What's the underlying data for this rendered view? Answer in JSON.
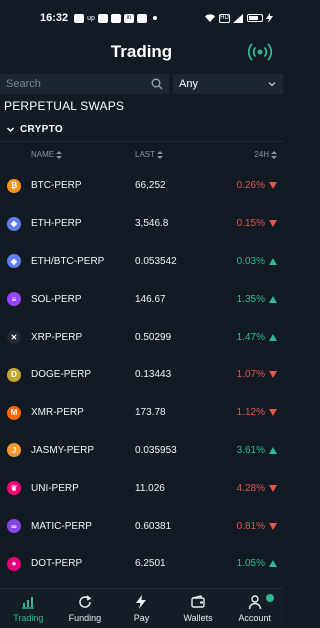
{
  "status_bar": {
    "time": "16:32",
    "icons": [
      "app-icon",
      "up-icon",
      "mail-icon",
      "mail-icon",
      "linkedin-icon",
      "chat-icon",
      "dot-icon"
    ],
    "right_icons": [
      "wifi-icon",
      "hd-icon",
      "signal-icon",
      "battery-icon",
      "lightning-icon"
    ]
  },
  "header": {
    "title": "Trading",
    "action_icon": "broadcast-icon"
  },
  "search": {
    "placeholder": "Search",
    "filter_value": "Any"
  },
  "section": {
    "title": "PERPETUAL SWAPS"
  },
  "group": {
    "title": "CRYPTO"
  },
  "columns": {
    "name": "NAME",
    "last": "LAST",
    "change": "24H"
  },
  "colors": {
    "background": "#121a24",
    "positive": "#2fb98e",
    "negative": "#e0584f",
    "accent": "#2fb98e"
  },
  "rows": [
    {
      "name": "BTC-PERP",
      "last": "66,252",
      "change": "0.26%",
      "dir": "down",
      "icon": "bitcoin-icon",
      "color": "#f7931a"
    },
    {
      "name": "ETH-PERP",
      "last": "3,546.8",
      "change": "0.15%",
      "dir": "down",
      "icon": "ethereum-icon",
      "color": "#627eea"
    },
    {
      "name": "ETH/BTC-PERP",
      "last": "0.053542",
      "change": "0.03%",
      "dir": "up",
      "icon": "ethereum-icon",
      "color": "#627eea"
    },
    {
      "name": "SOL-PERP",
      "last": "146.67",
      "change": "1.35%",
      "dir": "up",
      "icon": "solana-icon",
      "color": "#9945ff"
    },
    {
      "name": "XRP-PERP",
      "last": "0.50299",
      "change": "1.47%",
      "dir": "up",
      "icon": "xrp-icon",
      "color": "#23292f"
    },
    {
      "name": "DOGE-PERP",
      "last": "0.13443",
      "change": "1.07%",
      "dir": "down",
      "icon": "dogecoin-icon",
      "color": "#c2a633"
    },
    {
      "name": "XMR-PERP",
      "last": "173.78",
      "change": "1.12%",
      "dir": "down",
      "icon": "monero-icon",
      "color": "#ff6600"
    },
    {
      "name": "JASMY-PERP",
      "last": "0.035953",
      "change": "3.61%",
      "dir": "up",
      "icon": "jasmy-icon",
      "color": "#f29a2e"
    },
    {
      "name": "UNI-PERP",
      "last": "11.026",
      "change": "4.28%",
      "dir": "down",
      "icon": "uniswap-icon",
      "color": "#ff007a"
    },
    {
      "name": "MATIC-PERP",
      "last": "0.60381",
      "change": "0.81%",
      "dir": "down",
      "icon": "polygon-icon",
      "color": "#8247e5"
    },
    {
      "name": "DOT-PERP",
      "last": "6.2501",
      "change": "1.05%",
      "dir": "up",
      "icon": "polkadot-icon",
      "color": "#e6007a"
    }
  ],
  "tabs": [
    {
      "label": "Trading",
      "icon": "chart-icon",
      "active": true
    },
    {
      "label": "Funding",
      "icon": "refresh-icon",
      "active": false
    },
    {
      "label": "Pay",
      "icon": "lightning-icon",
      "active": false
    },
    {
      "label": "Wallets",
      "icon": "wallet-icon",
      "active": false
    },
    {
      "label": "Account",
      "icon": "user-icon",
      "active": false
    }
  ]
}
